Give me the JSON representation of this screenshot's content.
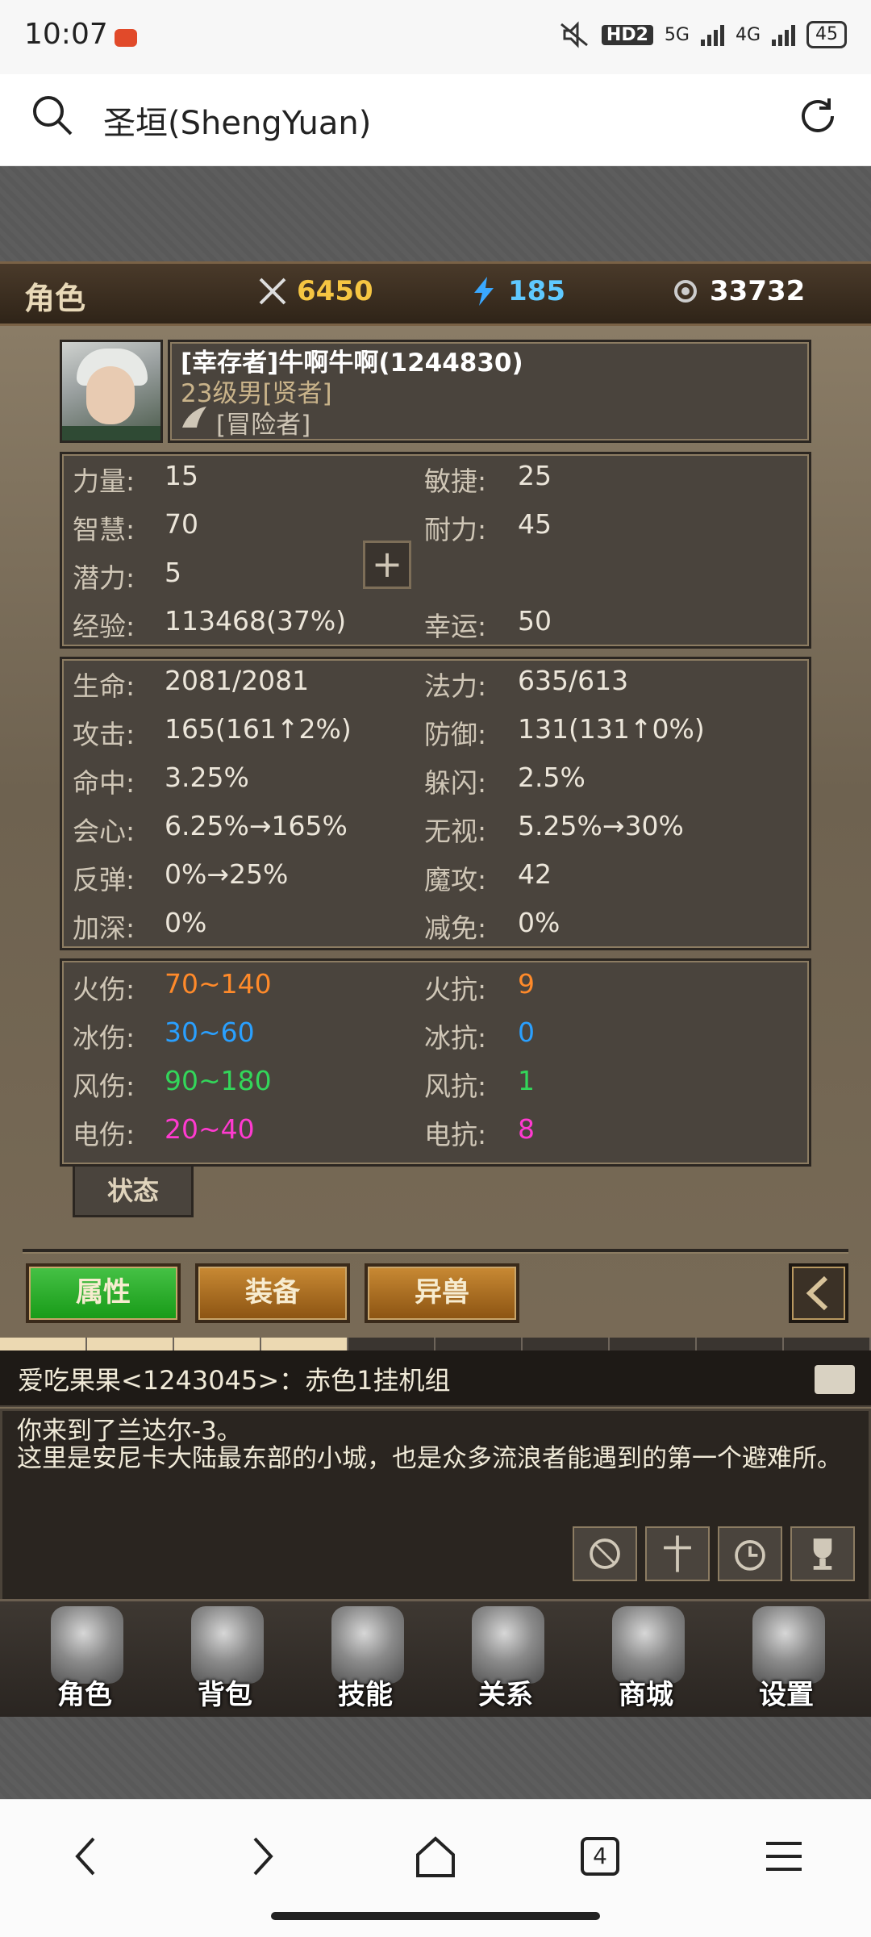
{
  "status": {
    "time": "10:07",
    "network1": "5G",
    "network2": "4G",
    "hd": "HD2",
    "battery": "45"
  },
  "browser": {
    "title": "圣垣(ShengYuan)"
  },
  "header": {
    "title": "角色",
    "attack": "6450",
    "energy": "185",
    "gold": "33732",
    "colors": {
      "attack": "#f5c542",
      "energy": "#5fc9ff",
      "gold": "#ffffff"
    }
  },
  "profile": {
    "name_line": "[幸存者]牛啊牛啊(1244830)",
    "level_line": "23级男[贤者]",
    "title_line": "[冒险者]"
  },
  "base_stats": {
    "left": [
      {
        "label": "力量:",
        "value": "15"
      },
      {
        "label": "智慧:",
        "value": "70"
      },
      {
        "label": "潜力:",
        "value": "5"
      },
      {
        "label": "经验:",
        "value": "113468(37%)"
      }
    ],
    "right": [
      {
        "label": "敏捷:",
        "value": "25"
      },
      {
        "label": "耐力:",
        "value": "45"
      },
      {
        "label": "幸运:",
        "value": "50"
      }
    ]
  },
  "combat_stats": {
    "left": [
      {
        "label": "生命:",
        "value": "2081/2081"
      },
      {
        "label": "攻击:",
        "value": "165(161↑2%)"
      },
      {
        "label": "命中:",
        "value": "3.25%"
      },
      {
        "label": "会心:",
        "value": "6.25%→165%"
      },
      {
        "label": "反弹:",
        "value": "0%→25%"
      },
      {
        "label": "加深:",
        "value": "0%"
      }
    ],
    "right": [
      {
        "label": "法力:",
        "value": "635/613"
      },
      {
        "label": "防御:",
        "value": "131(131↑0%)"
      },
      {
        "label": "躲闪:",
        "value": "2.5%"
      },
      {
        "label": "无视:",
        "value": "5.25%→30%"
      },
      {
        "label": "魔攻:",
        "value": "42"
      },
      {
        "label": "减免:",
        "value": "0%"
      }
    ]
  },
  "elemental_stats": {
    "left": [
      {
        "label": "火伤:",
        "value": "70~140",
        "color": "#ff8a2a"
      },
      {
        "label": "冰伤:",
        "value": "30~60",
        "color": "#2aa0ff"
      },
      {
        "label": "风伤:",
        "value": "90~180",
        "color": "#33d65a"
      },
      {
        "label": "电伤:",
        "value": "20~40",
        "color": "#ff3ad0"
      }
    ],
    "right": [
      {
        "label": "火抗:",
        "value": "9",
        "color": "#ff8a2a"
      },
      {
        "label": "冰抗:",
        "value": "0",
        "color": "#2aa0ff"
      },
      {
        "label": "风抗:",
        "value": "1",
        "color": "#33d65a"
      },
      {
        "label": "电抗:",
        "value": "8",
        "color": "#ff3ad0"
      }
    ]
  },
  "state_tab": "状态",
  "tabs": [
    {
      "label": "属性"
    },
    {
      "label": "装备"
    },
    {
      "label": "异兽"
    }
  ],
  "chat": {
    "line": "爱吃果果<1243045>：赤色1挂机组",
    "message": "你来到了兰达尔-3。\n这里是安尼卡大陆最东部的小城，也是众多流浪者能遇到的第一个避难所。"
  },
  "nav": [
    {
      "label": "角色"
    },
    {
      "label": "背包"
    },
    {
      "label": "技能"
    },
    {
      "label": "关系"
    },
    {
      "label": "商城"
    },
    {
      "label": "设置"
    }
  ],
  "browser_nav": {
    "tab_count": "4"
  }
}
